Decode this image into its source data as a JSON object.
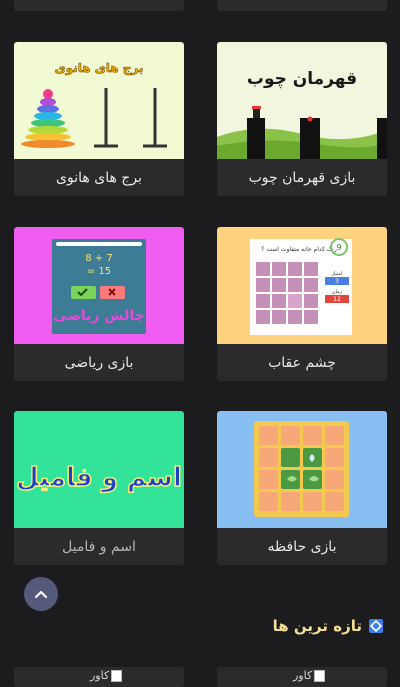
{
  "cards": [
    {
      "label": "برج های هانوی",
      "thumb_text": "برج های هانوی"
    },
    {
      "label": "بازی قهرمان چوب",
      "thumb_text": "قهرمان چوب"
    },
    {
      "label": "بازی ریاضی",
      "thumb_text": "چالش ریاضی",
      "eq1": "8 + 7",
      "eq2": "= 15"
    },
    {
      "label": "چشم عقاب",
      "thumb_text": "رنگ کدام خانه متفاوت است ؟",
      "level": "9",
      "score_label": "امتیاز",
      "score": "3",
      "time_label": "زمان",
      "time": "12"
    },
    {
      "label": "اسم و فامیل",
      "thumb_text": "اسم و فامیل"
    },
    {
      "label": "بازی حافظه"
    }
  ],
  "section": {
    "title": "تازه ترین ها"
  },
  "new_items": [
    {
      "alt": "کاور"
    },
    {
      "alt": "کاور"
    }
  ],
  "colors": {
    "background": "#1c1c1e",
    "card": "#2b2b2d",
    "section_title": "#f4df94",
    "scroll_button": "#55597a"
  }
}
